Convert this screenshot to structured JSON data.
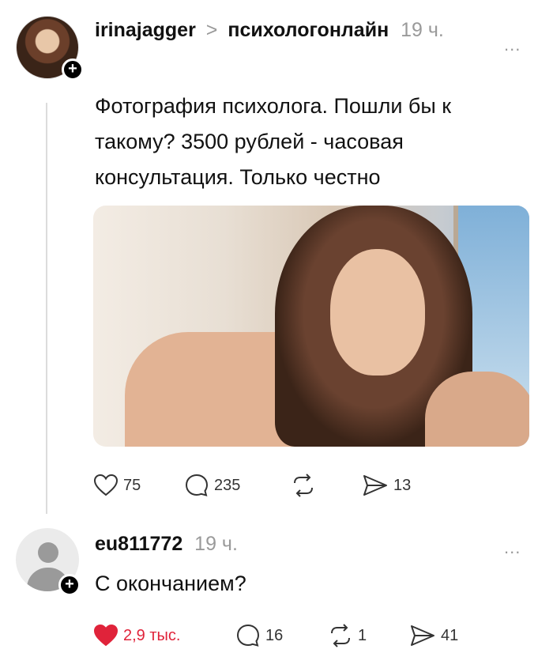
{
  "post": {
    "username": "irinajagger",
    "separator": ">",
    "community": "психологонлайн",
    "time": "19 ч.",
    "more": "...",
    "text": "Фотография психолога. Пошли бы к такому? 3500 рублей - часовая консультация. Только честно",
    "actions": {
      "likes": "75",
      "comments": "235",
      "shares": "13"
    }
  },
  "comment": {
    "username": "eu811772",
    "time": "19 ч.",
    "more": "...",
    "text": "С окончанием?",
    "actions": {
      "likes": "2,9 тыс.",
      "comments": "16",
      "reposts": "1",
      "shares": "41"
    }
  },
  "colors": {
    "like_active": "#e0233a",
    "muted": "#9a9a9a"
  },
  "icons": [
    "heart-icon",
    "comment-icon",
    "repost-icon",
    "share-icon",
    "plus-icon",
    "more-icon"
  ]
}
